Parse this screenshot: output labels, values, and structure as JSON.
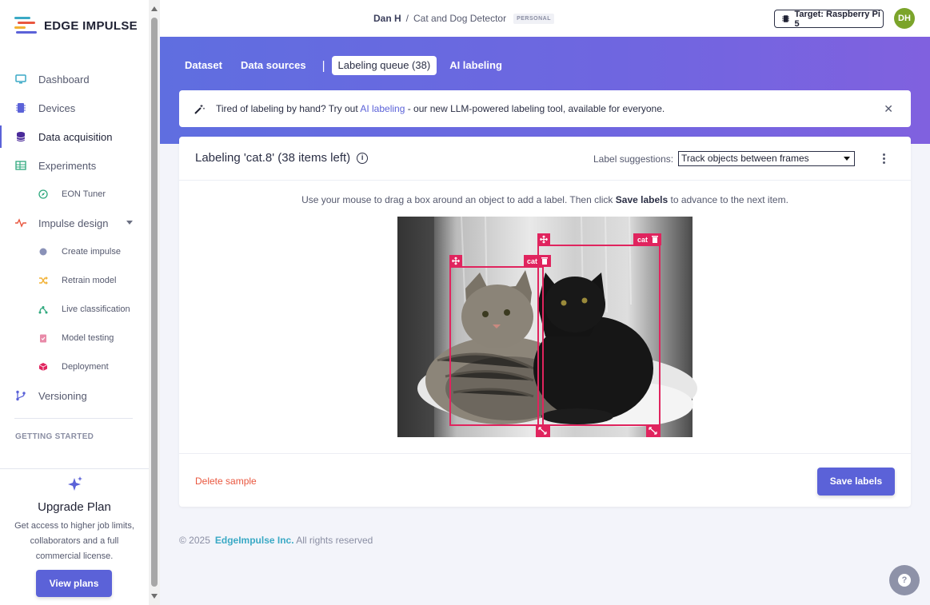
{
  "app": {
    "logo_text": "EDGE IMPULSE"
  },
  "sidebar": {
    "items": [
      {
        "label": "Dashboard"
      },
      {
        "label": "Devices"
      },
      {
        "label": "Data acquisition"
      },
      {
        "label": "Experiments"
      },
      {
        "label": "EON Tuner"
      },
      {
        "label": "Impulse design"
      },
      {
        "label": "Create impulse"
      },
      {
        "label": "Retrain model"
      },
      {
        "label": "Live classification"
      },
      {
        "label": "Model testing"
      },
      {
        "label": "Deployment"
      },
      {
        "label": "Versioning"
      }
    ],
    "section_label": "GETTING STARTED",
    "upgrade": {
      "title": "Upgrade Plan",
      "text": "Get access to higher job limits, collaborators and a full commercial license.",
      "button": "View plans"
    }
  },
  "topbar": {
    "user": "Dan H",
    "separator": "/",
    "project": "Cat and Dog Detector",
    "badge": "PERSONAL",
    "target": "Target: Raspberry Pi 5",
    "avatar_initials": "DH"
  },
  "tabs": [
    {
      "label": "Dataset"
    },
    {
      "label": "Data sources"
    },
    {
      "label": "Labeling queue (38)"
    },
    {
      "label": "AI labeling"
    }
  ],
  "tab_separator": "|",
  "banner": {
    "text_before": "Tired of labeling by hand? Try out ",
    "link": "AI labeling",
    "text_after": " - our new LLM-powered labeling tool, available for everyone."
  },
  "labeling": {
    "title": "Labeling 'cat.8' (38 items left)",
    "suggestions_label": "Label suggestions:",
    "suggestions_value": "Track objects between frames",
    "instruction_before": "Use your mouse to drag a box around an object to add a label. Then click ",
    "instruction_bold": "Save labels",
    "instruction_after": " to advance to the next item.",
    "boxes": [
      {
        "label": "cat"
      },
      {
        "label": "cat"
      }
    ],
    "delete_label": "Delete sample",
    "save_label": "Save labels"
  },
  "footer": {
    "copyright": "© 2025",
    "company": "EdgeImpulse Inc.",
    "rights": " All rights reserved"
  },
  "colors": {
    "accent": "#5b62d8",
    "box": "#e0245e",
    "danger": "#e9573f",
    "avatar": "#7ba42a"
  }
}
